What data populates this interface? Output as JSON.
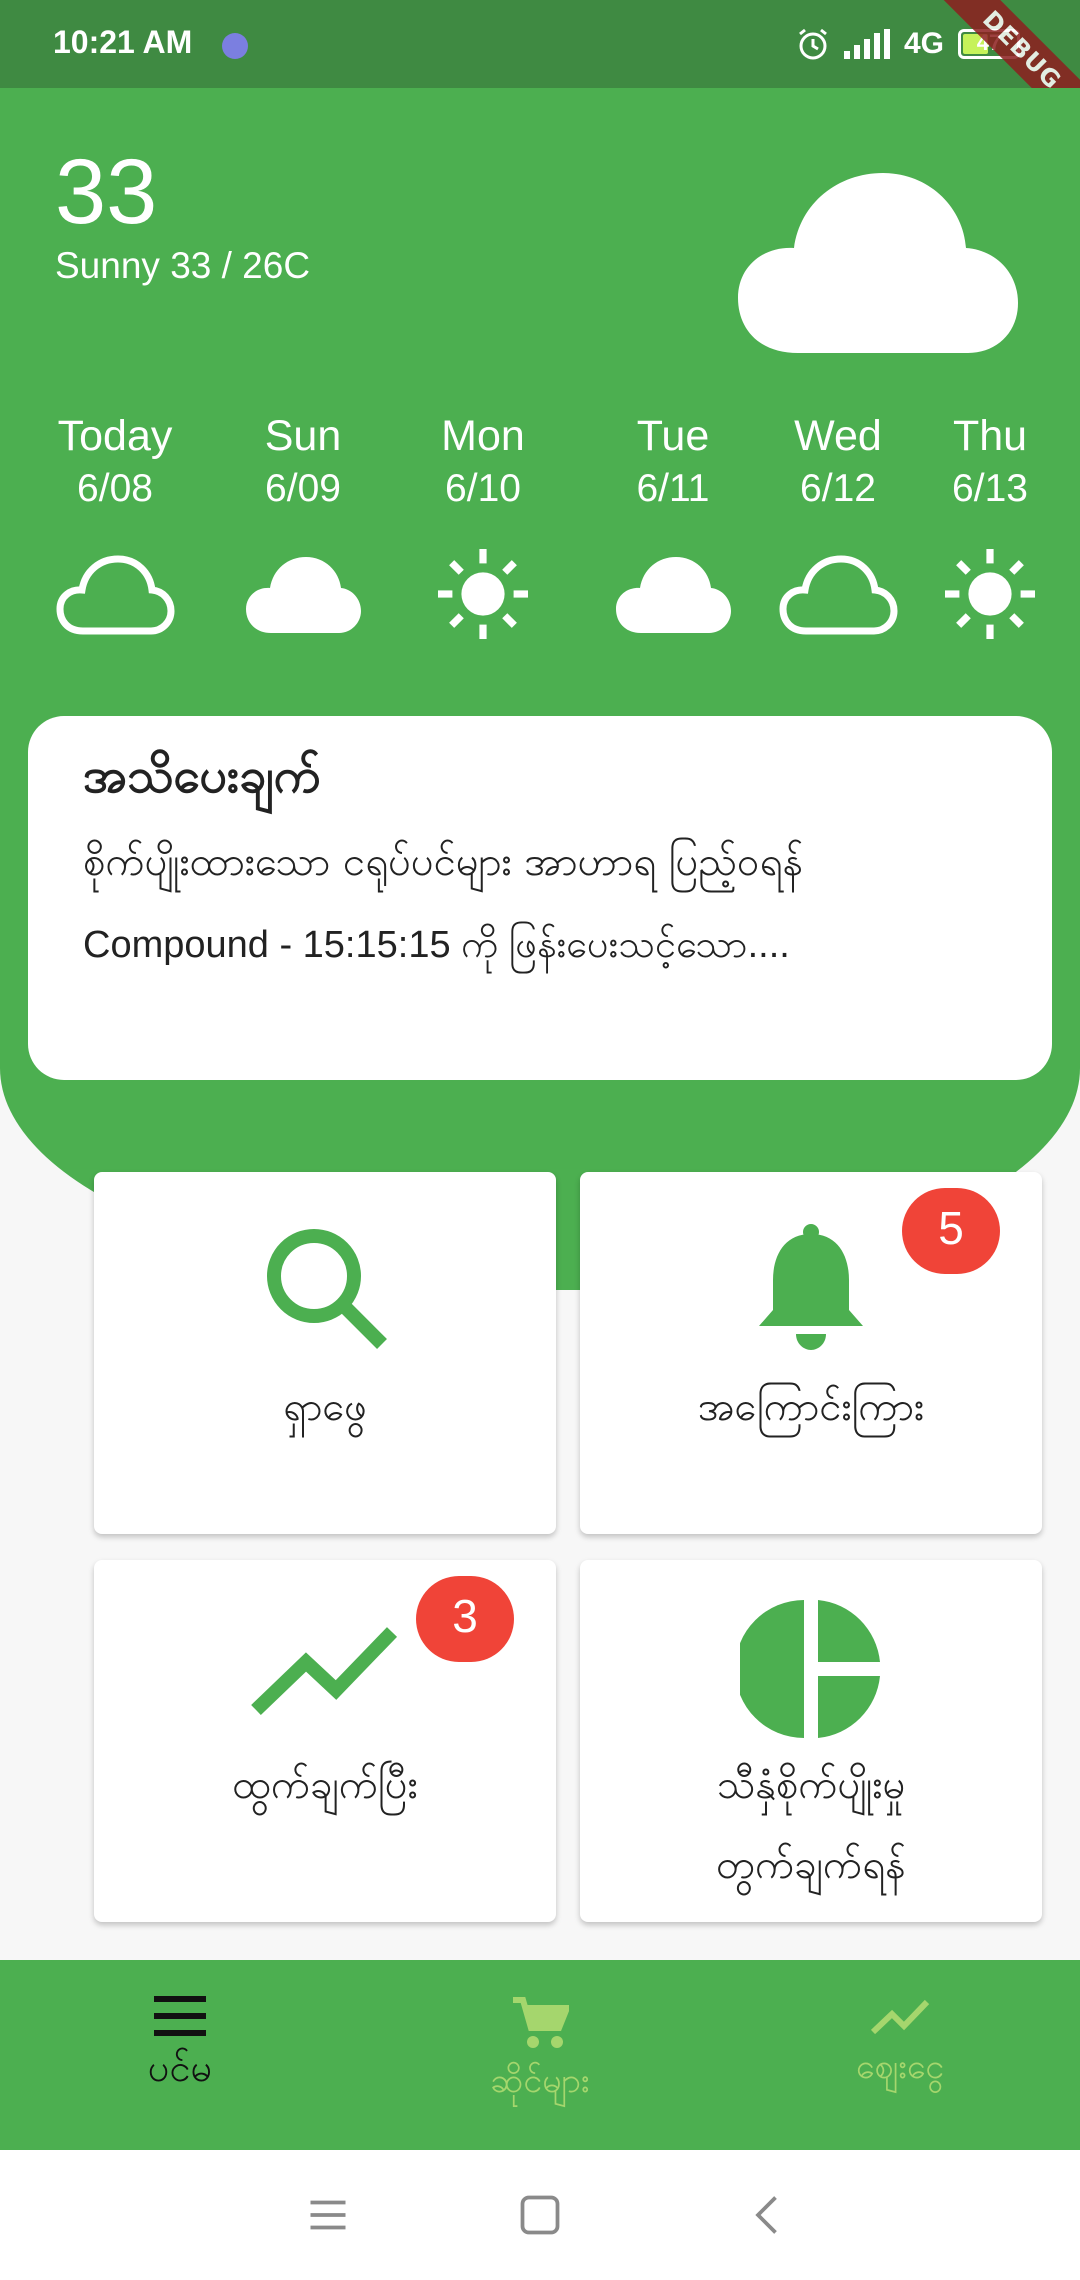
{
  "status_bar": {
    "time": "10:21 AM",
    "network": "4G",
    "battery": "47",
    "debug_label": "DEBUG"
  },
  "weather": {
    "current_temp": "33",
    "current_desc": "Sunny 33 / 26C",
    "current_icon": "cloud-icon",
    "forecast": [
      {
        "day": "Today",
        "date": "6/08",
        "icon": "cloud-outline-icon"
      },
      {
        "day": "Sun",
        "date": "6/09",
        "icon": "cloud-icon"
      },
      {
        "day": "Mon",
        "date": "6/10",
        "icon": "sun-icon"
      },
      {
        "day": "Tue",
        "date": "6/11",
        "icon": "cloud-icon"
      },
      {
        "day": "Wed",
        "date": "6/12",
        "icon": "cloud-outline-icon"
      },
      {
        "day": "Thu",
        "date": "6/13",
        "icon": "sun-icon"
      }
    ]
  },
  "notice": {
    "title": "အသိပေးချက်",
    "line1": "စိုက်ပျိုးထားသော ငရုပ်ပင်များ အာဟာရ ပြည့်ဝရန်",
    "line2": "Compound - 15:15:15 ကို ဖြန်းပေးသင့်သော...."
  },
  "tiles": [
    {
      "label": "ရှာဖွေ",
      "icon": "search-icon",
      "badge": ""
    },
    {
      "label": "အကြောင်းကြား",
      "icon": "bell-icon",
      "badge": "5"
    },
    {
      "label": "ထွက်ချက်ပြီး",
      "icon": "trending-up-icon",
      "badge": "3"
    },
    {
      "label_line1": "သီနှံစိုက်ပျိုးမှု",
      "label_line2": "တွက်ချက်ရန်",
      "icon": "pie-chart-icon",
      "badge": ""
    }
  ],
  "bottom_nav": [
    {
      "label": "ပင်မ",
      "icon": "menu-icon",
      "active": true
    },
    {
      "label": "ဆိုင်များ",
      "icon": "cart-icon",
      "active": false
    },
    {
      "label": "ဈေးငွေ",
      "icon": "trending-up-icon",
      "active": false
    }
  ],
  "colors": {
    "primary": "#4caf50",
    "status_bar": "#3f8a42",
    "badge": "#f04438",
    "inactive_nav": "#a5d66d"
  }
}
